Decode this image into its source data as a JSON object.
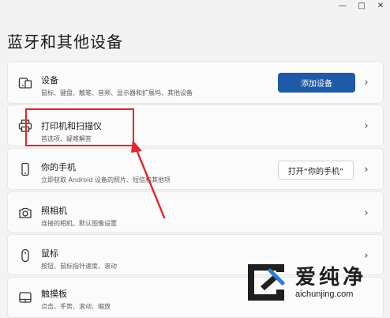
{
  "window": {
    "minimize_glyph": "—",
    "maximize_glyph": "□",
    "close_glyph": "✕"
  },
  "page": {
    "title": "蓝牙和其他设备"
  },
  "items": [
    {
      "icon": "devices-icon",
      "name": "设备",
      "desc": "鼠标、键盘、触笔、音频、显示器和扩展坞、其他设备",
      "button": "添加设备"
    },
    {
      "icon": "printer-icon",
      "name": "打印机和扫描仪",
      "desc": "首选项、疑难解答"
    },
    {
      "icon": "phone-icon",
      "name": "你的手机",
      "desc": "立即获取 Android 设备的照片、短信和其他项",
      "button": "打开“你的手机”"
    },
    {
      "icon": "camera-icon",
      "name": "照相机",
      "desc": "连接的相机、默认图像设置"
    },
    {
      "icon": "mouse-icon",
      "name": "鼠标",
      "desc": "按钮、鼠标指针速度、滚动"
    },
    {
      "icon": "touchpad-icon",
      "name": "触摸板",
      "desc": "点击、手势、滚动、缩放"
    }
  ],
  "chevron_glyph": "›",
  "watermark": {
    "text": "爱纯净",
    "url": "aichunjing.com"
  },
  "colors": {
    "accent": "#1f5aa6",
    "highlight": "#e0262f",
    "background": "#f3f3f3",
    "card": "#fbfbfb"
  }
}
